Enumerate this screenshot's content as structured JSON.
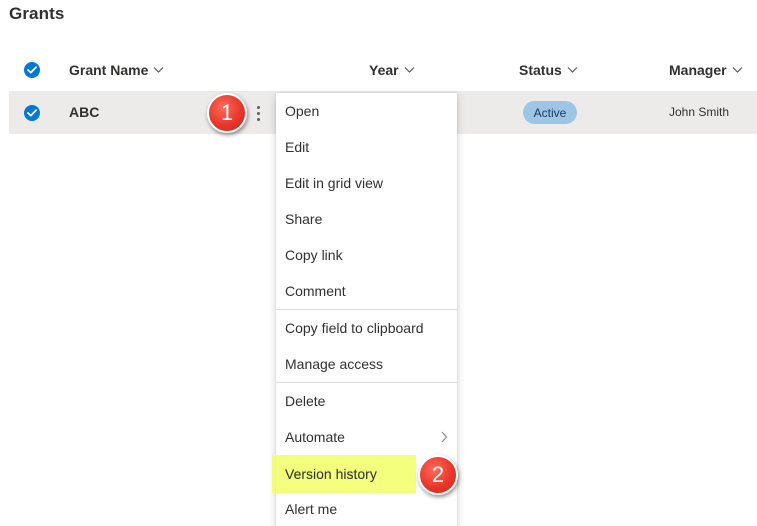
{
  "page": {
    "title": "Grants"
  },
  "columns": [
    {
      "label": "Grant Name"
    },
    {
      "label": "Year"
    },
    {
      "label": "Status"
    },
    {
      "label": "Manager"
    }
  ],
  "rows": [
    {
      "grant_name": "ABC",
      "year": "",
      "status": "Active",
      "manager": "John Smith",
      "selected": true
    }
  ],
  "context_menu": {
    "items": [
      {
        "label": "Open"
      },
      {
        "label": "Edit"
      },
      {
        "label": "Edit in grid view"
      },
      {
        "label": "Share"
      },
      {
        "label": "Copy link"
      },
      {
        "label": "Comment"
      },
      {
        "label": "Copy field to clipboard"
      },
      {
        "label": "Manage access"
      },
      {
        "label": "Delete"
      },
      {
        "label": "Automate",
        "has_submenu": true
      },
      {
        "label": "Version history",
        "highlighted": true
      },
      {
        "label": "Alert me"
      }
    ]
  },
  "annotations": [
    {
      "label": "1"
    },
    {
      "label": "2"
    }
  ],
  "colors": {
    "accent": "#0078d4",
    "row_selected_bg": "#edebe9",
    "status_active_bg": "#9ec4e6",
    "highlight": "#f2ff66",
    "badge": "#e8372a"
  },
  "icons": {
    "select_all": "checkmark-circle-icon",
    "row_select": "checkmark-circle-icon",
    "sort": "chevron-down-icon",
    "more": "more-vertical-icon",
    "submenu": "chevron-right-icon"
  }
}
